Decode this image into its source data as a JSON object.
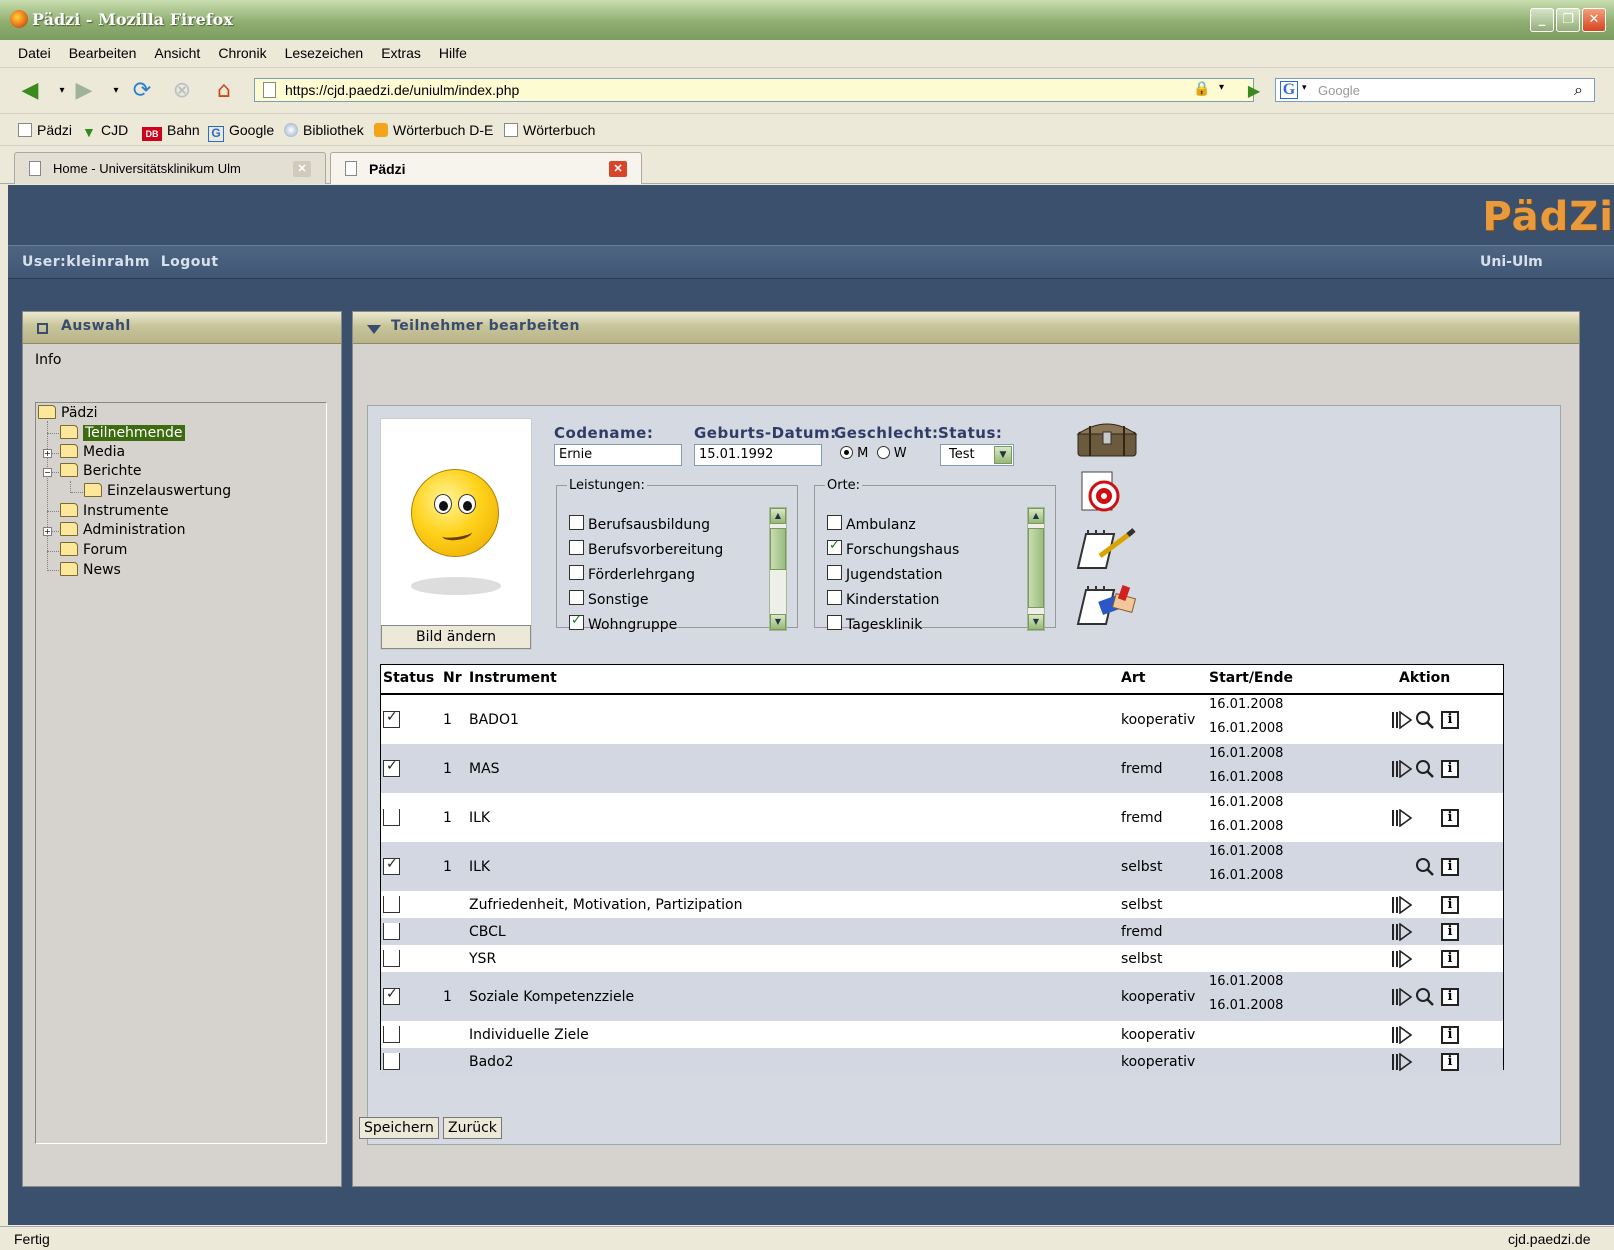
{
  "window": {
    "title": "Pädzi - Mozilla Firefox"
  },
  "menu": [
    "Datei",
    "Bearbeiten",
    "Ansicht",
    "Chronik",
    "Lesezeichen",
    "Extras",
    "Hilfe"
  ],
  "nav": {
    "url": "https://cjd.paedzi.de/uniulm/index.php",
    "search_placeholder": "Google"
  },
  "bookmarks": [
    "Pädzi",
    "CJD",
    "Bahn",
    "Google",
    "Bibliothek",
    "Wörterbuch D-E",
    "Wörterbuch"
  ],
  "bookmark_badges": {
    "bahn": "DB",
    "google": "G"
  },
  "tabs": [
    {
      "label": "Home - Universitätsklinikum Ulm",
      "active": false
    },
    {
      "label": "Pädzi",
      "active": true
    }
  ],
  "app": {
    "logo": "PädZi",
    "user": "User:kleinrahm",
    "logout": "Logout",
    "org": "Uni-Ulm"
  },
  "left": {
    "title": "Auswahl",
    "info": "Info",
    "tree": [
      "Pädzi",
      "Teilnehmende",
      "Media",
      "Berichte",
      "Einzelauswertung",
      "Instrumente",
      "Administration",
      "Forum",
      "News"
    ]
  },
  "main": {
    "title": "Teilnehmer bearbeiten",
    "photo_button": "Bild ändern",
    "fields": {
      "codename_label": "Codename:",
      "codename_value": "Ernie",
      "birth_label": "Geburts-Datum:",
      "birth_value": "15.01.1992",
      "gender_label": "Geschlecht:",
      "gender_m": "M",
      "gender_w": "W",
      "status_label": "Status:",
      "status_value": "Test"
    },
    "leistungen": {
      "legend": "Leistungen:",
      "items": [
        {
          "label": "Berufsausbildung",
          "checked": false
        },
        {
          "label": "Berufsvorbereitung",
          "checked": false
        },
        {
          "label": "Förderlehrgang",
          "checked": false
        },
        {
          "label": "Sonstige",
          "checked": false
        },
        {
          "label": "Wohngruppe",
          "checked": true
        }
      ]
    },
    "orte": {
      "legend": "Orte:",
      "items": [
        {
          "label": "Ambulanz",
          "checked": false
        },
        {
          "label": "Forschungshaus",
          "checked": true
        },
        {
          "label": "Jugendstation",
          "checked": false
        },
        {
          "label": "Kinderstation",
          "checked": false
        },
        {
          "label": "Tagesklinik",
          "checked": false
        }
      ]
    },
    "table": {
      "headers": [
        "Status",
        "Nr",
        "Instrument",
        "Art",
        "Start/Ende",
        "Aktion"
      ],
      "rows": [
        {
          "status": "checked",
          "nr": "1",
          "instrument": "BADO1",
          "art": "kooperativ",
          "start": "16.01.2008",
          "end": "16.01.2008",
          "play": true,
          "search": true,
          "info": true
        },
        {
          "status": "checked",
          "nr": "1",
          "instrument": "MAS",
          "art": "fremd",
          "start": "16.01.2008",
          "end": "16.01.2008",
          "play": true,
          "search": true,
          "info": true
        },
        {
          "status": "half",
          "nr": "1",
          "instrument": "ILK",
          "art": "fremd",
          "start": "16.01.2008",
          "end": "16.01.2008",
          "play": true,
          "search": false,
          "info": true
        },
        {
          "status": "checked",
          "nr": "1",
          "instrument": "ILK",
          "art": "selbst",
          "start": "16.01.2008",
          "end": "16.01.2008",
          "play": false,
          "search": true,
          "info": true
        },
        {
          "status": "open",
          "nr": "",
          "instrument": "Zufriedenheit, Motivation, Partizipation",
          "art": "selbst",
          "start": "",
          "end": "",
          "play": true,
          "search": false,
          "info": true
        },
        {
          "status": "open",
          "nr": "",
          "instrument": "CBCL",
          "art": "fremd",
          "start": "",
          "end": "",
          "play": true,
          "search": false,
          "info": true
        },
        {
          "status": "open",
          "nr": "",
          "instrument": "YSR",
          "art": "selbst",
          "start": "",
          "end": "",
          "play": true,
          "search": false,
          "info": true
        },
        {
          "status": "checked",
          "nr": "1",
          "instrument": "Soziale Kompetenzziele",
          "art": "kooperativ",
          "start": "16.01.2008",
          "end": "16.01.2008",
          "play": true,
          "search": true,
          "info": true
        },
        {
          "status": "open",
          "nr": "",
          "instrument": "Individuelle Ziele",
          "art": "kooperativ",
          "start": "",
          "end": "",
          "play": true,
          "search": false,
          "info": true
        },
        {
          "status": "open",
          "nr": "",
          "instrument": "Bado2",
          "art": "kooperativ",
          "start": "",
          "end": "",
          "play": true,
          "search": false,
          "info": true
        }
      ]
    },
    "buttons": {
      "save": "Speichern",
      "back": "Zurück"
    }
  },
  "statusbar": {
    "left": "Fertig",
    "right": "cjd.paedzi.de"
  },
  "colors": {
    "app_bg": "#3b506d",
    "accent": "#e89a3c",
    "panel_title": "#3a4b70"
  }
}
